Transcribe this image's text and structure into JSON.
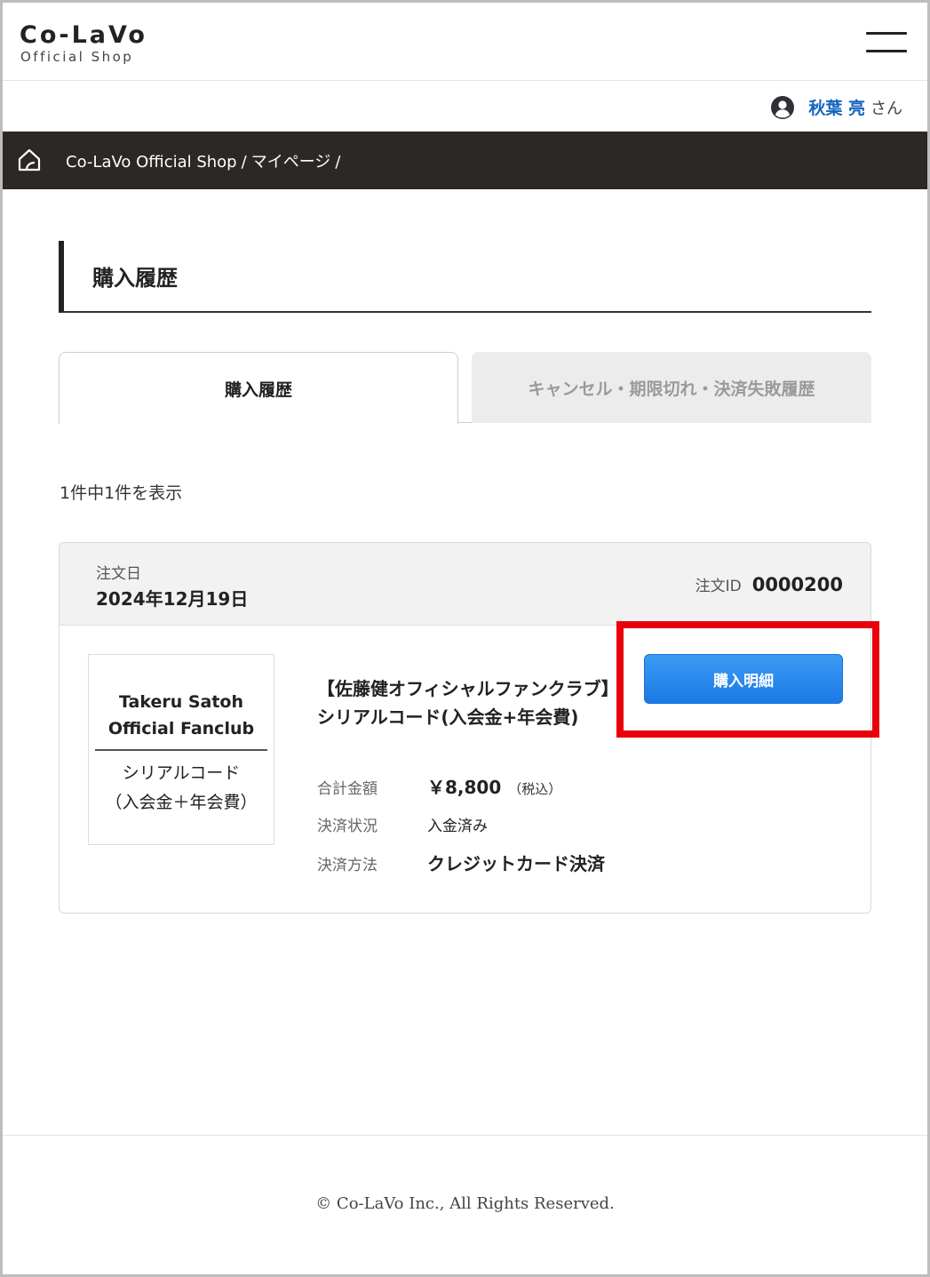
{
  "header": {
    "logo_main": "Co-LaVo",
    "logo_sub": "Official Shop"
  },
  "user": {
    "name": "秋葉 亮",
    "suffix": "さん"
  },
  "breadcrumb": {
    "items": [
      "Co-LaVo Official Shop",
      "マイページ"
    ],
    "separator": "/"
  },
  "page": {
    "title": "購入履歴"
  },
  "tabs": [
    {
      "label": "購入履歴",
      "active": true
    },
    {
      "label": "キャンセル・期限切れ・決済失敗履歴",
      "active": false
    }
  ],
  "results": {
    "count_text": "1件中1件を表示"
  },
  "order": {
    "date_label": "注文日",
    "date_value": "2024年12月19日",
    "id_label": "注文ID",
    "id_value": "0000200",
    "thumbnail": {
      "line1": "Takeru Satoh",
      "line2": "Official Fanclub",
      "line3": "シリアルコード",
      "line4": "（入会金＋年会費）"
    },
    "product_name": "【佐藤健オフィシャルファンクラブ】シリアルコード(入会金+年会費)",
    "total_label": "合計金額",
    "total_value": "￥8,800",
    "total_tax": "（税込）",
    "status_label": "決済状況",
    "status_value": "入金済み",
    "method_label": "決済方法",
    "method_value": "クレジットカード決済",
    "detail_button": "購入明細"
  },
  "footer": {
    "copyright": "© Co-LaVo Inc., All Rights Reserved."
  },
  "colors": {
    "accent_blue": "#1a7ae6",
    "user_name": "#1565c0",
    "breadcrumb_bg": "#2b2826",
    "highlight": "#e8000b"
  },
  "icons": {
    "menu": "hamburger-menu-icon",
    "user": "user-circle-icon",
    "home": "home-icon"
  }
}
